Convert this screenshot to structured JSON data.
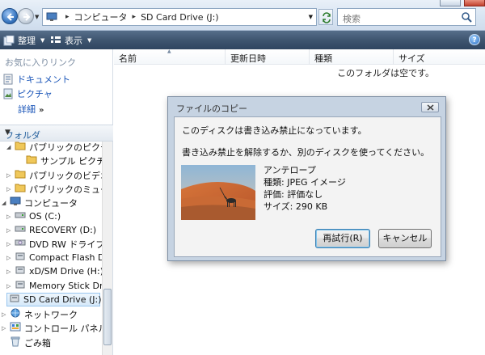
{
  "address_bar": {
    "breadcrumb": [
      "コンピュータ",
      "SD Card Drive (J:)"
    ],
    "search_placeholder": "検索"
  },
  "toolbar": {
    "organize_label": "整理",
    "views_label": "表示",
    "help_label": "?"
  },
  "sidebar": {
    "favorites_title": "お気に入りリンク",
    "favorites": [
      {
        "label": "ドキュメント",
        "icon": "documents-icon"
      },
      {
        "label": "ピクチャ",
        "icon": "pictures-icon"
      }
    ],
    "more_label": "詳細",
    "more_chevron": "»",
    "folders_title": "フォルダ",
    "tree": [
      {
        "label": "パブリックのピクチャ",
        "icon": "folder-icon",
        "expander": "expanded"
      },
      {
        "label": "サンプル ピクチャ",
        "icon": "folder-icon",
        "expander": "none"
      },
      {
        "label": "パブリックのビデオ",
        "icon": "folder-icon",
        "expander": "collapsed"
      },
      {
        "label": "パブリックのミュージック",
        "icon": "folder-icon",
        "expander": "collapsed"
      },
      {
        "label": "コンピュータ",
        "icon": "computer-icon",
        "expander": "expanded"
      },
      {
        "label": "OS (C:)",
        "icon": "drive-icon",
        "expander": "collapsed"
      },
      {
        "label": "RECOVERY (D:)",
        "icon": "drive-icon",
        "expander": "collapsed"
      },
      {
        "label": "DVD RW ドライブ (E:)",
        "icon": "dvd-drive-icon",
        "expander": "collapsed"
      },
      {
        "label": "Compact Flash Drive",
        "icon": "removable-drive-icon",
        "expander": "collapsed"
      },
      {
        "label": "xD/SM Drive (H:)",
        "icon": "removable-drive-icon",
        "expander": "collapsed"
      },
      {
        "label": "Memory Stick Drive",
        "icon": "removable-drive-icon",
        "expander": "collapsed"
      },
      {
        "label": "SD Card Drive (J:)",
        "icon": "removable-drive-icon",
        "expander": "none",
        "selected": true
      },
      {
        "label": "ネットワーク",
        "icon": "network-icon",
        "expander": "collapsed"
      },
      {
        "label": "コントロール パネル",
        "icon": "control-panel-icon",
        "expander": "collapsed"
      },
      {
        "label": "ごみ箱",
        "icon": "recycle-bin-icon",
        "expander": "none"
      }
    ]
  },
  "file_list": {
    "columns": [
      "名前",
      "更新日時",
      "種類",
      "サイズ"
    ],
    "empty_message": "このフォルダは空です。"
  },
  "dialog": {
    "title": "ファイルのコピー",
    "message_line1": "このディスクは書き込み禁止になっています。",
    "message_line2": "書き込み禁止を解除するか、別のディスクを使ってください。",
    "file": {
      "name": "アンテロープ",
      "type": "種類: JPEG イメージ",
      "rating": "評価: 評価なし",
      "size": "サイズ: 290 KB"
    },
    "retry_label": "再試行(R)",
    "cancel_label": "キャンセル"
  },
  "colors": {
    "toolbar_bg": "#3f5670",
    "link": "#1a55b8",
    "dialog_frame": "#c6d3e2",
    "selection": "#d6e9f9"
  }
}
